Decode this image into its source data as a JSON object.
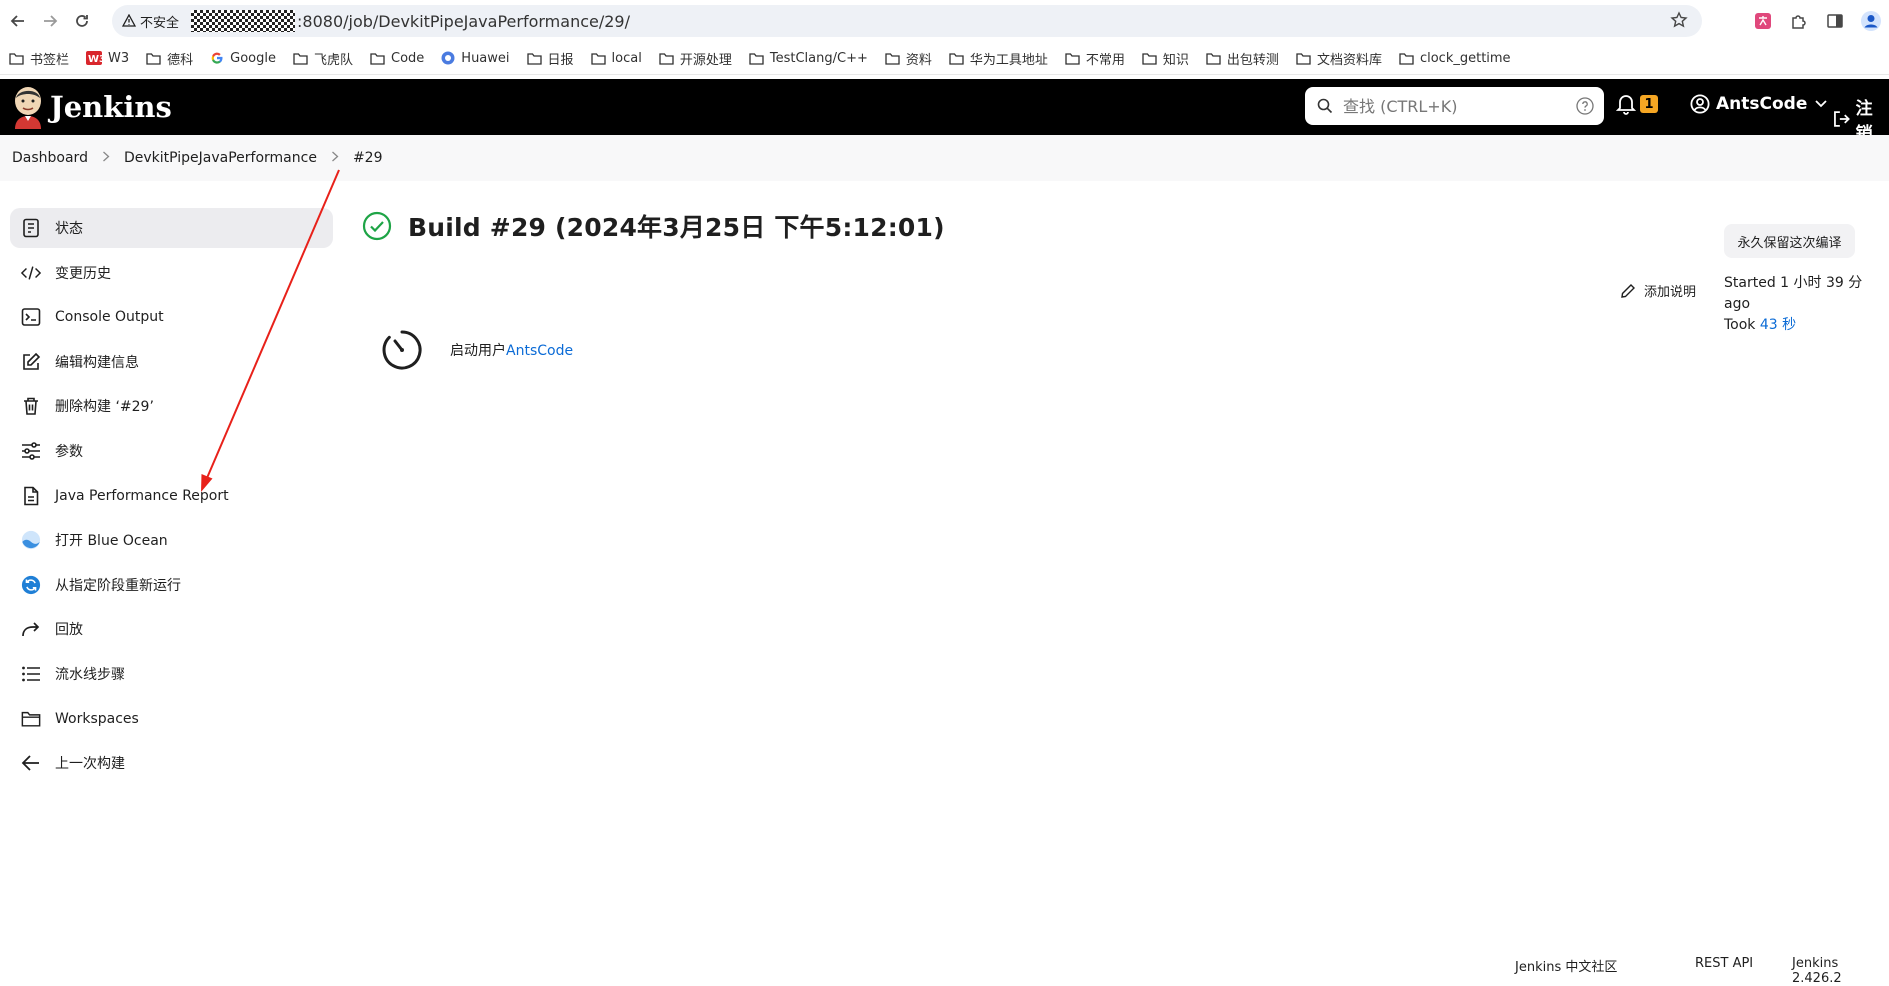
{
  "browser": {
    "security_label": "不安全",
    "url": ":8080/job/DevkitPipeJavaPerformance/29/",
    "bookmarks": [
      "书签栏",
      "W3",
      "德科",
      "Google",
      "飞虎队",
      "Code",
      "Huawei",
      "日报",
      "local",
      "开源处理",
      "TestClang/C++",
      "资料",
      "华为工具地址",
      "不常用",
      "知识",
      "出包转测",
      "文档资料库",
      "clock_gettime"
    ]
  },
  "header": {
    "logo_text": "Jenkins",
    "search_placeholder": "查找 (CTRL+K)",
    "notification_count": "1",
    "username": "AntsCode",
    "logout_label": "注销"
  },
  "breadcrumb": [
    "Dashboard",
    "DevkitPipeJavaPerformance",
    "#29"
  ],
  "sidebar": {
    "items": [
      {
        "label": "状态",
        "icon": "status-doc-icon"
      },
      {
        "label": "变更历史",
        "icon": "code-icon"
      },
      {
        "label": "Console Output",
        "icon": "terminal-icon"
      },
      {
        "label": "编辑构建信息",
        "icon": "edit-icon"
      },
      {
        "label": "删除构建 ‘#29’",
        "icon": "trash-icon"
      },
      {
        "label": "参数",
        "icon": "sliders-icon"
      },
      {
        "label": "Java Performance Report",
        "icon": "document-icon"
      },
      {
        "label": "打开 Blue Ocean",
        "icon": "blue-ocean-icon"
      },
      {
        "label": "从指定阶段重新运行",
        "icon": "restart-stage-icon"
      },
      {
        "label": "回放",
        "icon": "replay-icon"
      },
      {
        "label": "流水线步骤",
        "icon": "list-icon"
      },
      {
        "label": "Workspaces",
        "icon": "folder-icon"
      },
      {
        "label": "上一次构建",
        "icon": "arrow-left-icon"
      }
    ]
  },
  "main": {
    "title": "Build #29 (2024年3月25日 下午5:12:01)",
    "keep_button": "永久保留这次编译",
    "add_description": "添加说明",
    "started": "Started 1 小时 39 分 ago",
    "took_prefix": "Took ",
    "took_value": "43 秒",
    "cause_prefix": "启动用户",
    "cause_user": "AntsCode"
  },
  "footer": {
    "community": "Jenkins 中文社区",
    "rest_api": "REST API",
    "version": "Jenkins 2.426.2"
  },
  "colors": {
    "header_bg": "#000000",
    "link": "#0b6bd6",
    "success": "#1ea446",
    "annotation_arrow": "#e8211a",
    "badge": "#f5a623"
  }
}
